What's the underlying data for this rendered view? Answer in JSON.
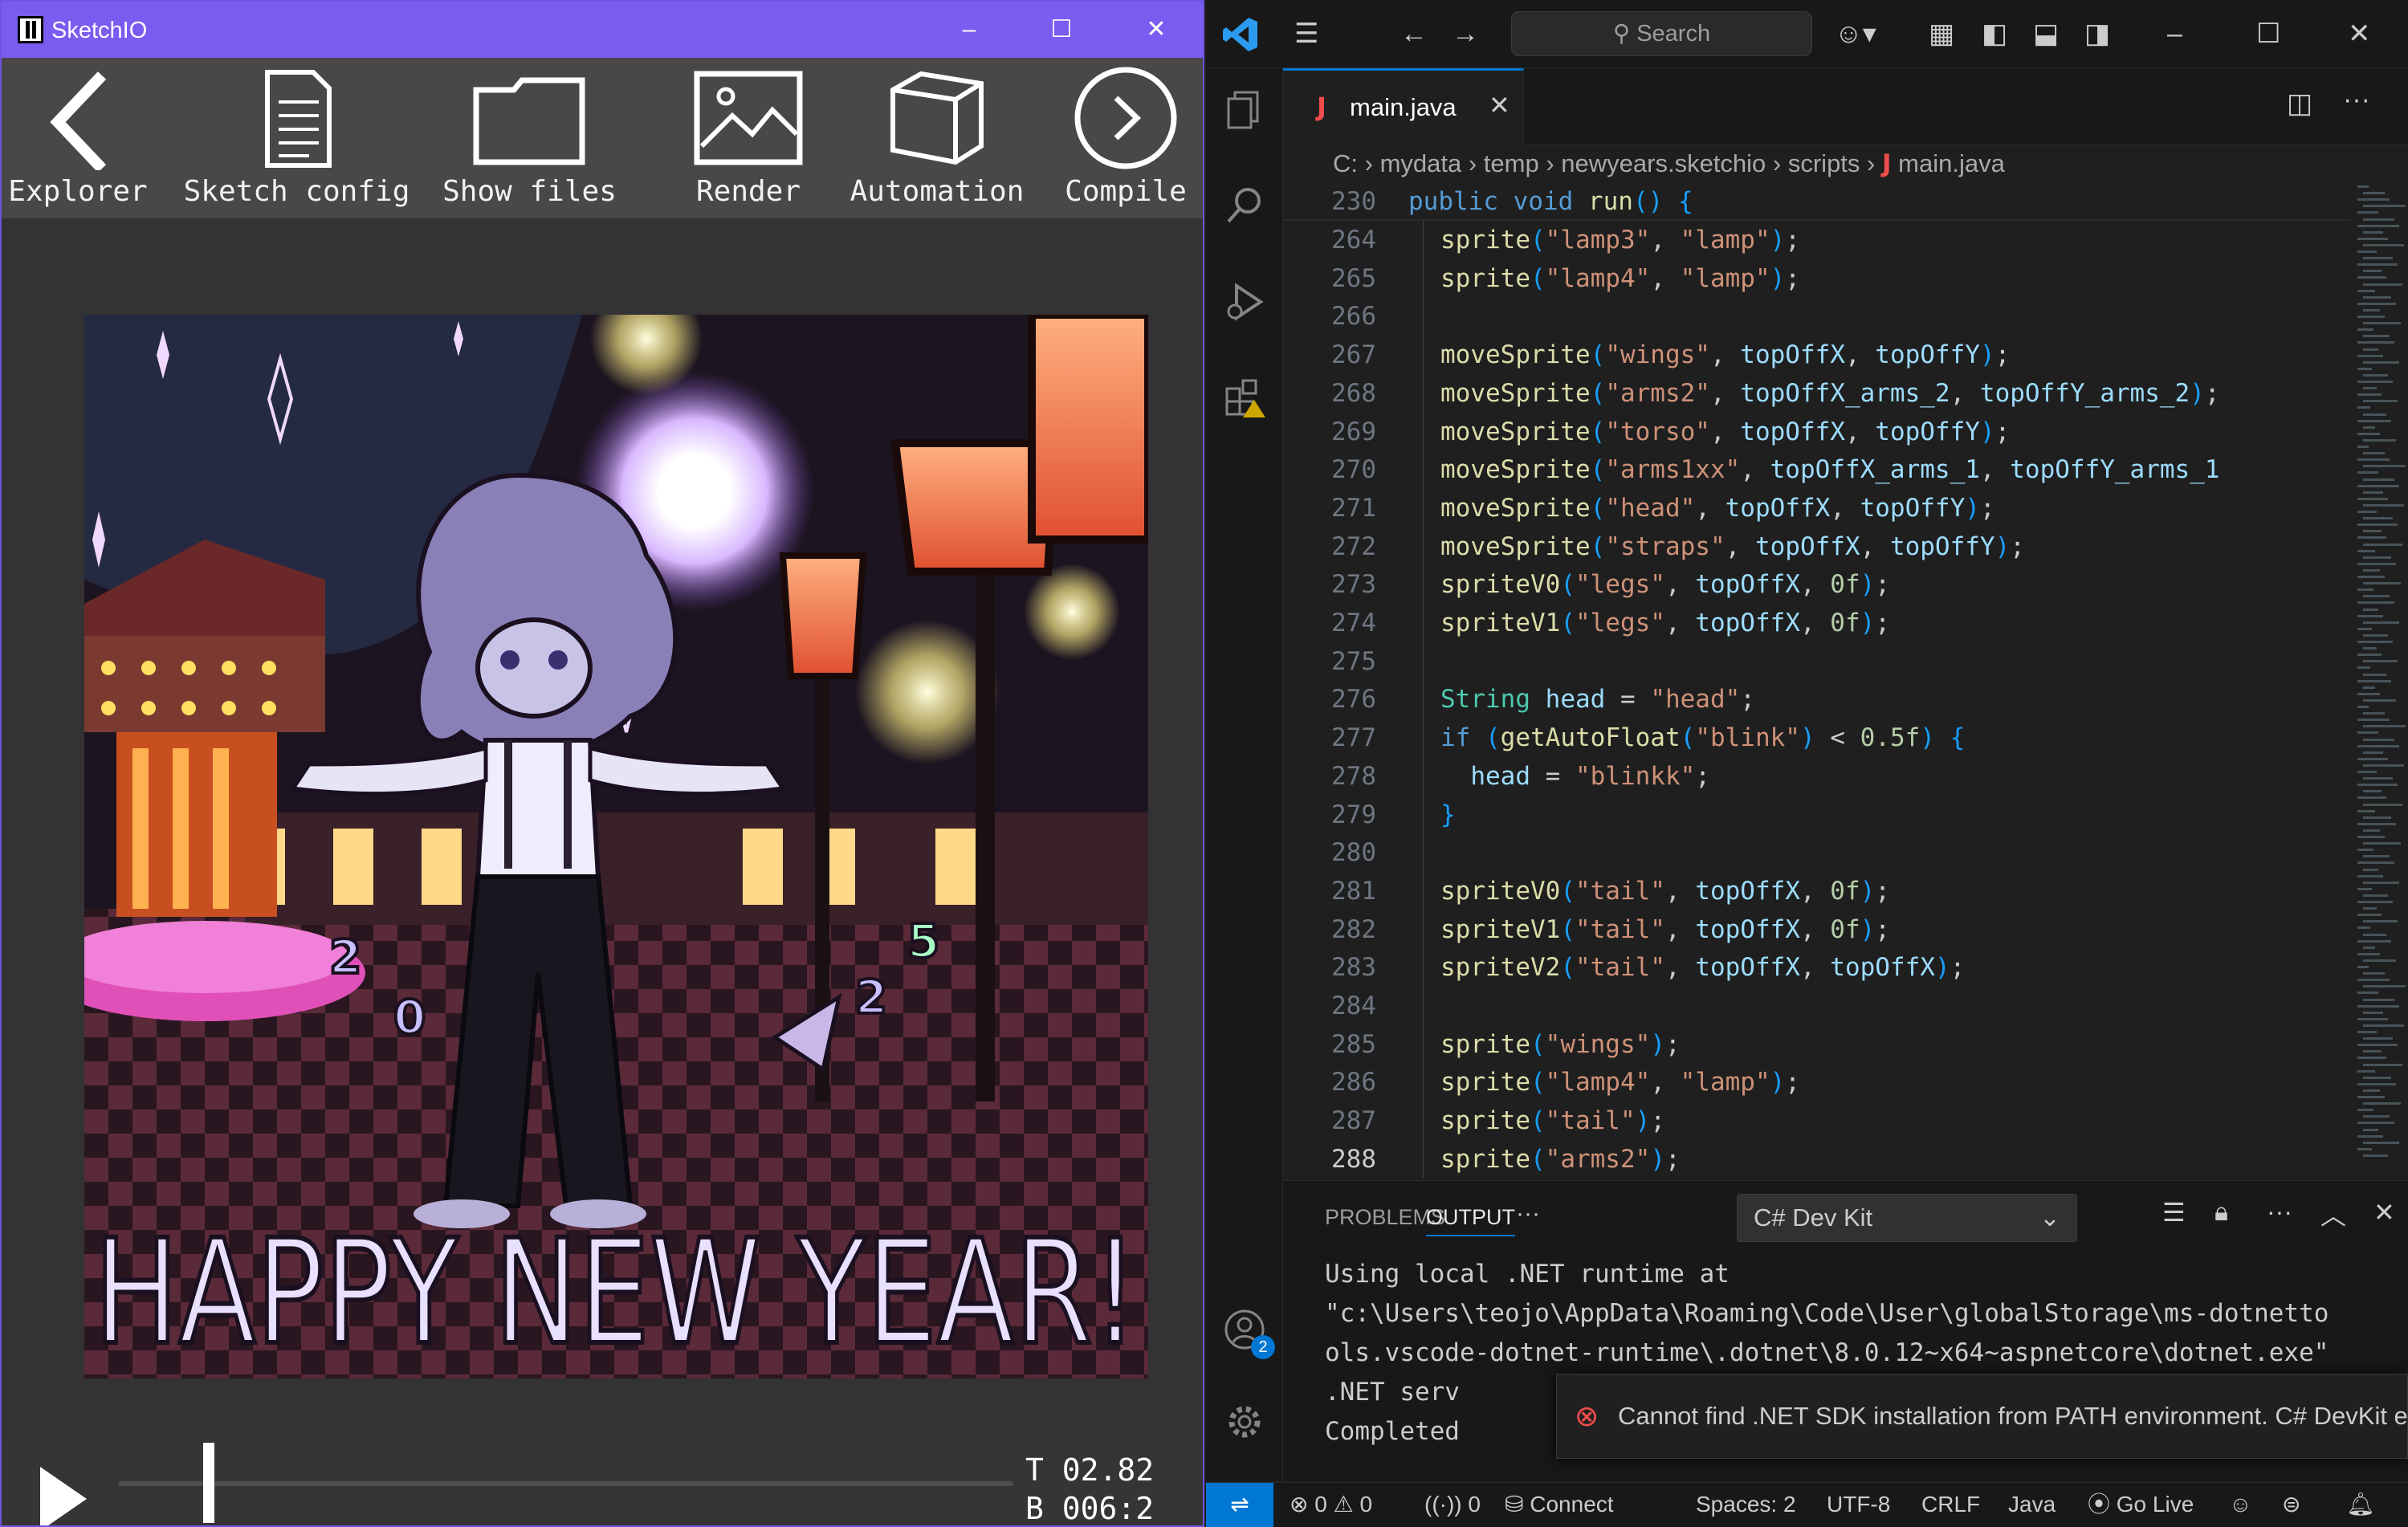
{
  "sketchio": {
    "title": "SketchIO",
    "toolbar": [
      {
        "label": "Explorer",
        "icon": "back-arrow-icon"
      },
      {
        "label": "Sketch config",
        "icon": "document-icon"
      },
      {
        "label": "Show files",
        "icon": "folder-icon"
      },
      {
        "label": "Render",
        "icon": "image-icon"
      },
      {
        "label": "Automation",
        "icon": "cube-icon"
      },
      {
        "label": "Compile",
        "icon": "play-circle-icon"
      }
    ],
    "artwork": {
      "greeting": "HAPPY NEW YEAR!",
      "digits": [
        "2",
        "0",
        "2",
        "5"
      ]
    },
    "player": {
      "time_label": "T 02.82",
      "beat_label": "B 006:2",
      "progress": 0.095
    }
  },
  "vscode": {
    "search_placeholder": "Search",
    "tab": {
      "name": "main.java",
      "icon_letter": "J"
    },
    "breadcrumb": [
      "C:",
      "mydata",
      "temp",
      "newyears.sketchio",
      "scripts",
      "main.java"
    ],
    "sticky_line": {
      "num": "230",
      "text": "public void run() {"
    },
    "lines": [
      {
        "num": "264",
        "text": "sprite(\"lamp3\", \"lamp\");"
      },
      {
        "num": "265",
        "text": "sprite(\"lamp4\", \"lamp\");"
      },
      {
        "num": "266",
        "text": ""
      },
      {
        "num": "267",
        "text": "moveSprite(\"wings\", topOffX, topOffY);"
      },
      {
        "num": "268",
        "text": "moveSprite(\"arms2\", topOffX_arms_2, topOffY_arms_2);"
      },
      {
        "num": "269",
        "text": "moveSprite(\"torso\", topOffX, topOffY);"
      },
      {
        "num": "270",
        "text": "moveSprite(\"arms1xx\", topOffX_arms_1, topOffY_arms_1"
      },
      {
        "num": "271",
        "text": "moveSprite(\"head\", topOffX, topOffY);"
      },
      {
        "num": "272",
        "text": "moveSprite(\"straps\", topOffX, topOffY);"
      },
      {
        "num": "273",
        "text": "spriteV0(\"legs\", topOffX, 0f);"
      },
      {
        "num": "274",
        "text": "spriteV1(\"legs\", topOffX, 0f);"
      },
      {
        "num": "275",
        "text": ""
      },
      {
        "num": "276",
        "text": "String head = \"head\";"
      },
      {
        "num": "277",
        "text": "if (getAutoFloat(\"blink\") < 0.5f) {"
      },
      {
        "num": "278",
        "text": "  head = \"blinkk\";"
      },
      {
        "num": "279",
        "text": "}"
      },
      {
        "num": "280",
        "text": ""
      },
      {
        "num": "281",
        "text": "spriteV0(\"tail\", topOffX, 0f);"
      },
      {
        "num": "282",
        "text": "spriteV1(\"tail\", topOffX, 0f);"
      },
      {
        "num": "283",
        "text": "spriteV2(\"tail\", topOffX, topOffX);"
      },
      {
        "num": "284",
        "text": ""
      },
      {
        "num": "285",
        "text": "sprite(\"wings\");"
      },
      {
        "num": "286",
        "text": "sprite(\"lamp4\", \"lamp\");"
      },
      {
        "num": "287",
        "text": "sprite(\"tail\");"
      },
      {
        "num": "288",
        "text": "sprite(\"arms2\");"
      }
    ],
    "panel": {
      "tabs": [
        "PROBLEMS",
        "OUTPUT"
      ],
      "active_tab": "OUTPUT",
      "channel": "C# Dev Kit",
      "output_lines": [
        "Using local .NET runtime at",
        "\"c:\\Users\\teojo\\AppData\\Roaming\\Code\\User\\globalStorage\\ms-dotnetto",
        "ols.vscode-dotnet-runtime\\.dotnet\\8.0.12~x64~aspnetcore\\dotnet.exe\"",
        ".NET serv",
        "Completed"
      ],
      "notification": "Cannot find .NET SDK installation from PATH environment. C# DevKit e..."
    },
    "accounts_badge": "2",
    "status": {
      "errors": "0",
      "warnings": "0",
      "ports": "0",
      "connect": "Connect",
      "spaces": "Spaces: 2",
      "encoding": "UTF-8",
      "eol": "CRLF",
      "language": "Java",
      "golive": "Go Live"
    },
    "colors": {
      "accent": "#0078d4",
      "error": "#f14c4c",
      "sketch_title": "#7a5cf0"
    }
  }
}
